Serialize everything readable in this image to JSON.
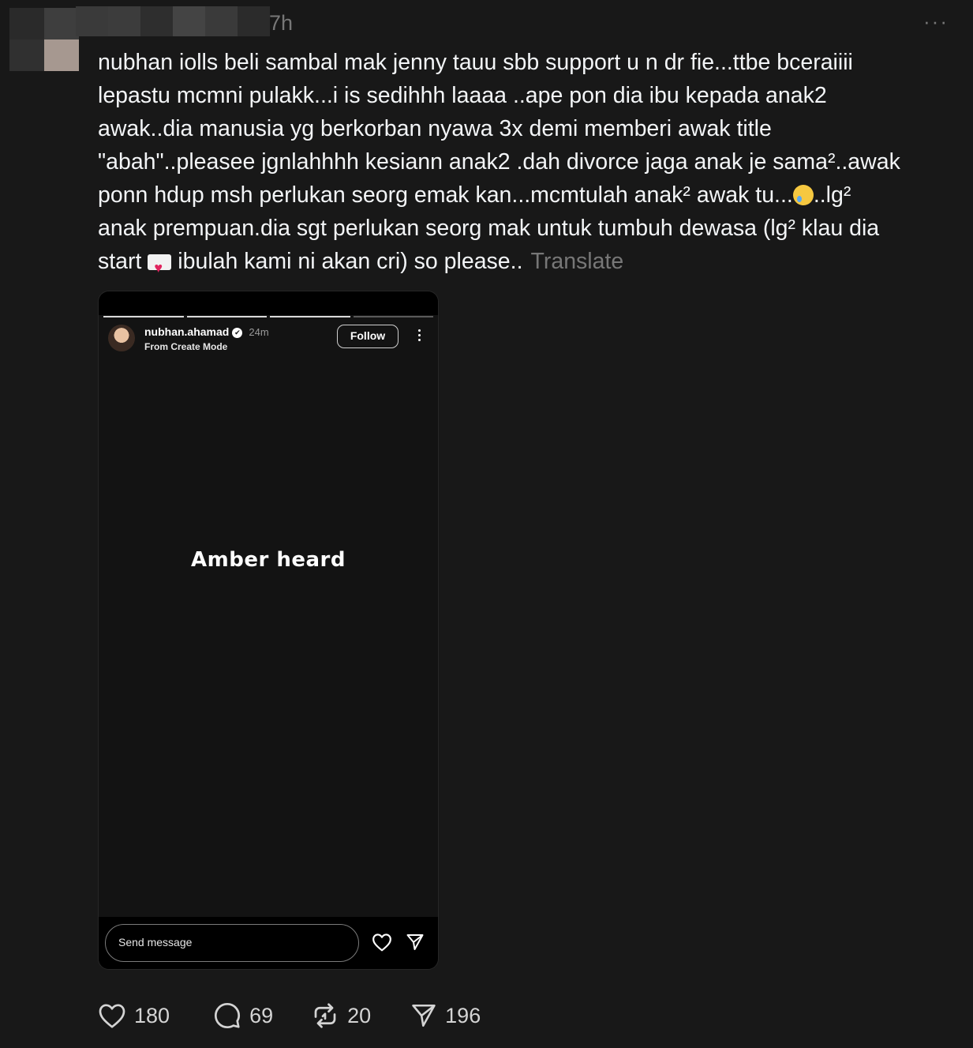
{
  "header": {
    "time_ago": "7h",
    "more_label": "···"
  },
  "post": {
    "lines": [
      "nubhan iolls beli sambal mak jenny tauu sbb support u n dr fie...ttbe bceraiiii",
      "lepastu mcmni pulakk...i is sedihhh laaaa ..ape pon dia ibu kepada anak2",
      "awak..dia manusia yg berkorban nyawa 3x demi memberi awak title",
      "\"abah\"..pleasee jgnlahhhh kesiann anak2 .dah divorce jaga anak je sama²..awak",
      "ponn hdup msh perlukan seorg emak kan...mcmtulah anak² awak tu...",
      "..lg²",
      "anak prempuan.dia sgt perlukan seorg mak untuk tumbuh dewasa (lg² klau dia",
      "start",
      "ibulah kami ni akan cri) so please.."
    ],
    "translate_label": "Translate"
  },
  "story": {
    "username": "nubhan.ahamad",
    "verified_mark": "✔",
    "age": "24m",
    "subtitle": "From Create Mode",
    "follow_label": "Follow",
    "caption": "Amber heard",
    "message_placeholder": "Send message"
  },
  "actions": {
    "likes": "180",
    "replies": "69",
    "reposts": "20",
    "shares": "196"
  },
  "colors": {
    "background": "#181818",
    "text": "#f3f5f7",
    "muted": "#777777"
  }
}
